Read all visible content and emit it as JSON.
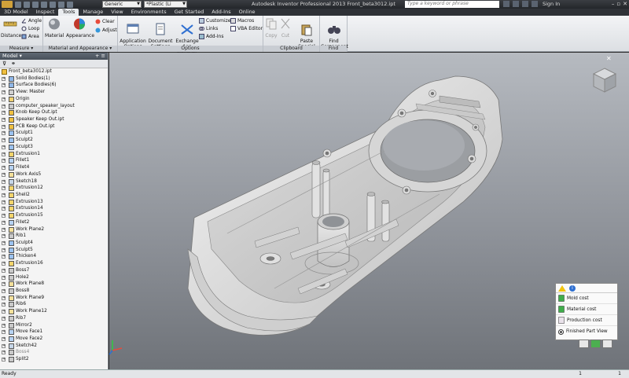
{
  "titlebar": {
    "title": "Autodesk Inventor Professional 2013    Front_beta3012.ipt",
    "appearance_combo": "Generic",
    "material_combo": "*Plastic (Li",
    "search_placeholder": "Type a keyword or phrase",
    "signin": "Sign In"
  },
  "tabs": [
    "3D Model",
    "Inspect",
    "Tools",
    "Manage",
    "View",
    "Environments",
    "Get Started",
    "Add-Ins",
    "Online"
  ],
  "active_tab": "Tools",
  "ribbon": {
    "measure": {
      "label": "Measure",
      "distance": "Distance",
      "angle": "Angle",
      "loop": "Loop",
      "area": "Area"
    },
    "material_appearance": {
      "label": "Material and Appearance",
      "material": "Material",
      "appearance": "Appearance",
      "clear": "Clear",
      "adjust": "Adjust"
    },
    "options": {
      "label": "Options",
      "app_options": "Application\nOptions",
      "doc_settings": "Document\nSettings",
      "exchange": "Exchange\nApp Manager",
      "customize": "Customize",
      "links": "Links",
      "addins": "Add-Ins",
      "macros": "Macros",
      "vba": "VBA Editor"
    },
    "clipboard": {
      "label": "Clipboard",
      "copy": "Copy",
      "cut": "Cut",
      "paste_special": "Paste\nSpecial"
    },
    "find": {
      "label": "Find",
      "find_component": "Find\nComponent"
    }
  },
  "browser": {
    "header": "Model",
    "root": "Front_beta3012.ipt",
    "nodes": [
      "Solid Bodies(1)",
      "Surface Bodies(6)",
      "View: Master",
      "Origin",
      "computer_speaker_layout",
      "Knob Keep Out.ipt",
      "Speaker Keep Out.ipt",
      "PCB Keep Out.ipt",
      "Sculpt1",
      "Sculpt2",
      "Sculpt3",
      "Extrusion1",
      "Fillet1",
      "Fillet4",
      "Work Axis5",
      "Sketch18",
      "Extrusion12",
      "Shell2",
      "Extrusion13",
      "Extrusion14",
      "Extrusion15",
      "Fillet2",
      "Work Plane2",
      "Rib1",
      "Sculpt4",
      "Sculpt5",
      "Thicken4",
      "Extrusion16",
      "Boss7",
      "Hole2",
      "Work Plane8",
      "Boss8",
      "Work Plane9",
      "Rib6",
      "Work Plane12",
      "Rib7",
      "Mirror2",
      "Move Face1",
      "Move Face2",
      "Sketch42",
      "Boss4",
      "Split2"
    ]
  },
  "cost_panel": {
    "mold_cost": "Mold cost",
    "material_cost": "Material cost",
    "production_cost": "Production cost",
    "finished_part_view": "Finished Part View"
  },
  "status": {
    "left": "Ready",
    "right1": "1",
    "right2": "1"
  },
  "colors": {
    "ribbon_bg": "#e4e7eb",
    "viewport_top": "#b6bac0",
    "viewport_bottom": "#6f7379",
    "part": "#e8e8e8",
    "accent_green": "#4caf50"
  }
}
